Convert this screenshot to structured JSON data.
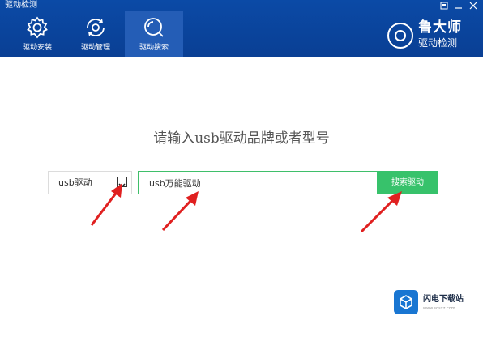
{
  "window": {
    "title": "驱动检测",
    "controls": [
      "pin-icon",
      "minimize-icon",
      "close-icon"
    ]
  },
  "tabs": [
    {
      "label": "驱动安装",
      "icon": "gear-icon",
      "active": false
    },
    {
      "label": "驱动管理",
      "icon": "refresh-icon",
      "active": false
    },
    {
      "label": "驱动搜索",
      "icon": "search-icon",
      "active": true
    }
  ],
  "brand": {
    "name": "鲁大师",
    "sub": "驱动检测"
  },
  "prompt": "请输入usb驱动品牌或者型号",
  "search": {
    "category_value": "usb驱动",
    "input_value": "usb万能驱动",
    "button_label": "搜索驱动"
  },
  "watermark": {
    "name": "闪电下载站",
    "url": "www.sdsxz.com"
  },
  "colors": {
    "header": "#0b4aa6",
    "accent": "#37c26b",
    "arrow": "#e02020"
  }
}
